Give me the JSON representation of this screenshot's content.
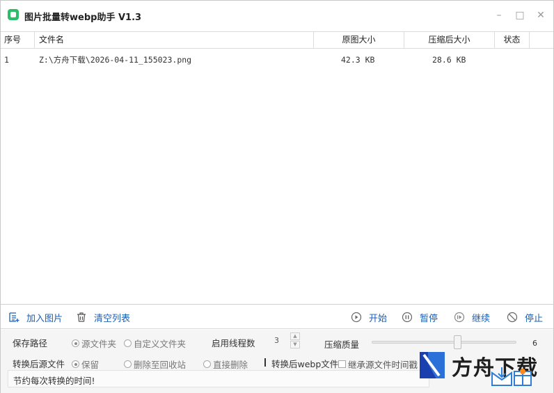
{
  "window": {
    "title": "图片批量转webp助手 V1.3",
    "minimize_icon": "minimize-icon",
    "maximize_icon": "maximize-icon",
    "close_icon": "close-icon"
  },
  "table": {
    "headers": [
      "序号",
      "文件名",
      "原图大小",
      "压缩后大小",
      "状态"
    ],
    "rows": [
      {
        "index": "1",
        "filename": "Z:\\方舟下载\\2026-04-11_155023.png",
        "original_size": "42.3 KB",
        "compressed_size": "28.6 KB",
        "status": ""
      }
    ]
  },
  "toolbar": {
    "add_images": "加入图片",
    "clear_list": "清空列表",
    "start": "开始",
    "pause": "暂停",
    "resume": "继续",
    "stop": "停止"
  },
  "settings": {
    "save_path_label": "保存路径",
    "save_path_options": [
      "源文件夹",
      "自定义文件夹"
    ],
    "threads_label": "启用线程数",
    "threads_value": "3",
    "quality_label": "压缩质量",
    "quality_value": "6",
    "quality_level": 0.57,
    "source_after_label": "转换后源文件",
    "source_after_options": [
      "保留",
      "删除至回收站",
      "直接删除"
    ],
    "webp_after_label": "转换后webp文件",
    "inherit_time_label": "继承源文件时间戳"
  },
  "status": {
    "message": "节约每次转换的时间!"
  },
  "watermark": {
    "text": "方舟下载"
  },
  "colors": {
    "accent": "#1b5fb5",
    "app_icon": "#2bbd6a"
  }
}
